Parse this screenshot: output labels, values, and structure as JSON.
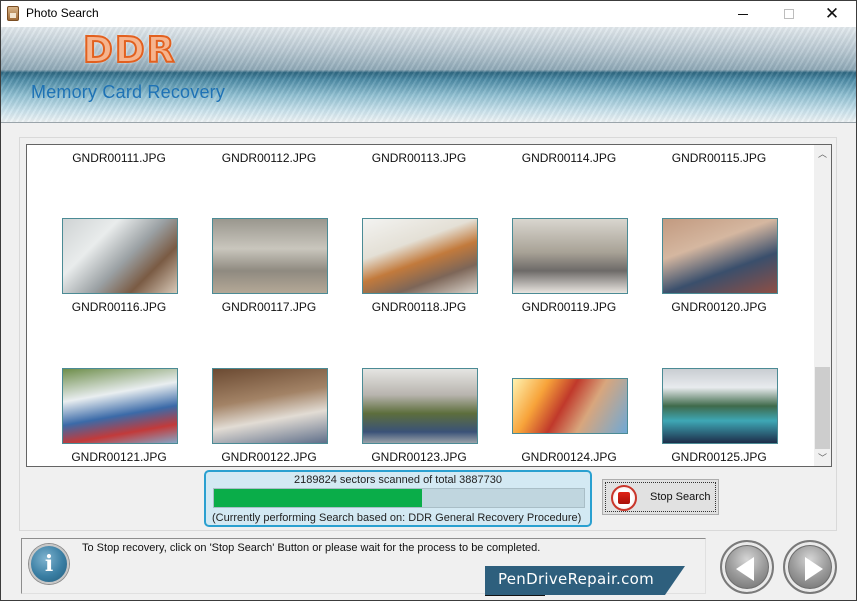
{
  "window": {
    "title": "Photo Search",
    "controls": {
      "minimize": "minimize",
      "maximize": "maximize",
      "close": "close"
    }
  },
  "banner": {
    "brand": "DDR",
    "product": "Memory Card Recovery"
  },
  "gallery": {
    "rows": [
      {
        "partial": true,
        "items": [
          {
            "name": "GNDR00111.JPG"
          },
          {
            "name": "GNDR00112.JPG"
          },
          {
            "name": "GNDR00113.JPG"
          },
          {
            "name": "GNDR00114.JPG"
          },
          {
            "name": "GNDR00115.JPG"
          }
        ]
      },
      {
        "items": [
          {
            "name": "GNDR00116.JPG",
            "thumbnail": "woman-photographing-temple"
          },
          {
            "name": "GNDR00117.JPG",
            "thumbnail": "tourists-on-temple-stairs"
          },
          {
            "name": "GNDR00118.JPG",
            "thumbnail": "backpacker-at-thai-temple"
          },
          {
            "name": "GNDR00119.JPG",
            "thumbnail": "excited-couple-with-phone"
          },
          {
            "name": "GNDR00120.JPG",
            "thumbnail": "friends-reading-map"
          }
        ]
      },
      {
        "items": [
          {
            "name": "GNDR00121.JPG",
            "thumbnail": "friends-taking-selfie"
          },
          {
            "name": "GNDR00122.JPG",
            "thumbnail": "women-on-street-cafe"
          },
          {
            "name": "GNDR00123.JPG",
            "thumbnail": "hikers-high-five"
          },
          {
            "name": "GNDR00124.JPG",
            "thumbnail": "friends-selfie-sunlight"
          },
          {
            "name": "GNDR00125.JPG",
            "thumbnail": "woman-hiker-mountain-lake"
          }
        ]
      }
    ],
    "scroll_position": 0.72
  },
  "progress": {
    "scanned": 2189824,
    "total": 3887730,
    "status_text": "2189824 sectors scanned of total 3887730",
    "fraction": 0.563,
    "procedure_text": "(Currently performing Search based on:  DDR General Recovery Procedure)",
    "fill_color": "#0aad49"
  },
  "stop_button": {
    "label": "Stop Search"
  },
  "info": {
    "icon": "info-icon",
    "message": "To Stop recovery, click on 'Stop Search' Button or please wait for the process to be completed."
  },
  "footer": {
    "brand_link": "PenDriveRepair.com",
    "prev_label": "Back",
    "next_label": "Next"
  }
}
